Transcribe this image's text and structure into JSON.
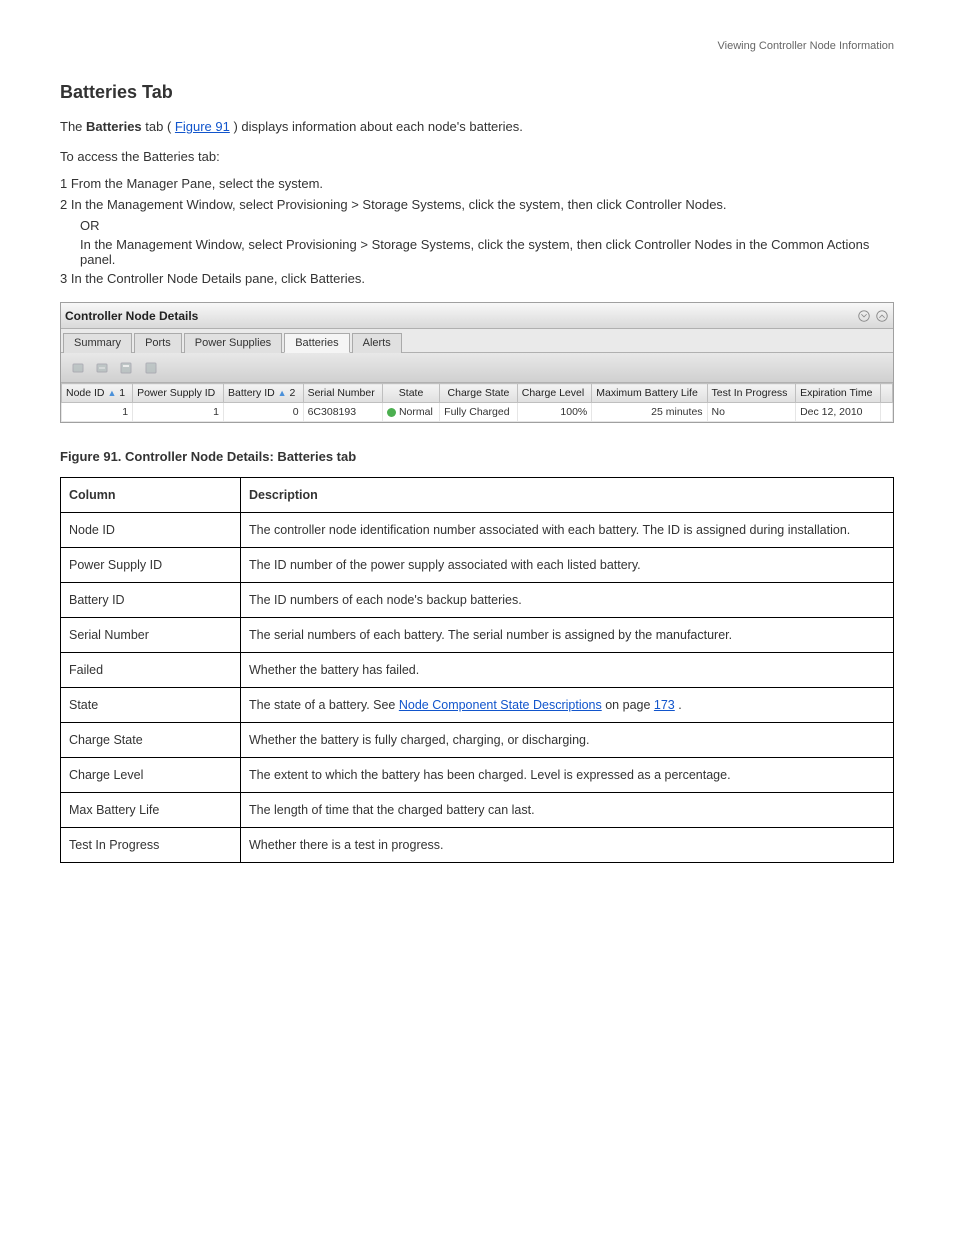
{
  "page_header": "Viewing Controller Node Information",
  "section_title": "Batteries Tab",
  "intro_line_1": "The ",
  "intro_bold": "Batteries",
  "intro_line_2": " tab (",
  "intro_link": "Figure 91",
  "intro_line_3": ") displays information about each node's batteries.",
  "intro_para2": "To access the Batteries tab:",
  "step_1": "1 From the Manager Pane, select the system.",
  "step_2a": "2 In the Management Window, select Provisioning > Storage Systems, click the system, then click Controller Nodes.",
  "step_or": "OR",
  "step_2b": "In the Management Window, select Provisioning > Storage Systems, click the system, then click Controller Nodes in the Common Actions panel.",
  "step_3": "3 In the Controller Node Details pane, click Batteries.",
  "ui": {
    "title": "Controller Node Details",
    "icon1_aria": "collapse-icon",
    "icon2_aria": "expand-icon",
    "tabs": [
      "Summary",
      "Ports",
      "Power Supplies",
      "Batteries",
      "Alerts"
    ],
    "active_tab_index": 3,
    "columns": [
      {
        "label": "Node ID",
        "sort": "1"
      },
      {
        "label": "Power Supply ID"
      },
      {
        "label": "Battery ID",
        "sort": "2"
      },
      {
        "label": "Serial Number"
      },
      {
        "label": "State"
      },
      {
        "label": "Charge State"
      },
      {
        "label": "Charge Level"
      },
      {
        "label": "Maximum Battery Life"
      },
      {
        "label": "Test In Progress"
      },
      {
        "label": "Expiration Time"
      }
    ],
    "row": {
      "node_id": "1",
      "power_supply_id": "1",
      "battery_id": "0",
      "serial": "6C308193",
      "state": "Normal",
      "charge_state": "Fully Charged",
      "charge_level": "100%",
      "max_life": "25 minutes",
      "test_in_progress": "No",
      "expiration": "Dec 12, 2010"
    }
  },
  "figure_caption": "Figure 91. Controller Node Details: Batteries tab",
  "desc_table": {
    "headers": [
      "Column",
      "Description"
    ],
    "rows": [
      {
        "c": "Node ID",
        "d": "The controller node identification number associated with each battery. The ID is assigned during installation."
      },
      {
        "c": "Power Supply ID",
        "d": "The ID number of the power supply associated with each listed battery."
      },
      {
        "c": "Battery ID",
        "d": "The ID numbers of each node's backup batteries."
      },
      {
        "c": "Serial Number",
        "d": "The serial numbers of each battery. The serial number is assigned by the manufacturer."
      },
      {
        "c": "Failed",
        "d": "Whether the battery has failed."
      },
      {
        "c": "State",
        "d_pre": "The state of a battery. See ",
        "d_link": "Node Component State Descriptions",
        "d_post": " on ",
        "d_page_pre": "page ",
        "d_page_link": "173",
        "d_end": "."
      },
      {
        "c": "Charge State",
        "d": "Whether the battery is fully charged, charging, or discharging."
      },
      {
        "c": "Charge Level",
        "d": "The extent to which the battery has been charged. Level is expressed as a percentage."
      },
      {
        "c": "Max Battery Life",
        "d": "The length of time that the charged battery can last."
      },
      {
        "c": "Test In Progress",
        "d": "Whether there is a test in progress."
      }
    ]
  }
}
